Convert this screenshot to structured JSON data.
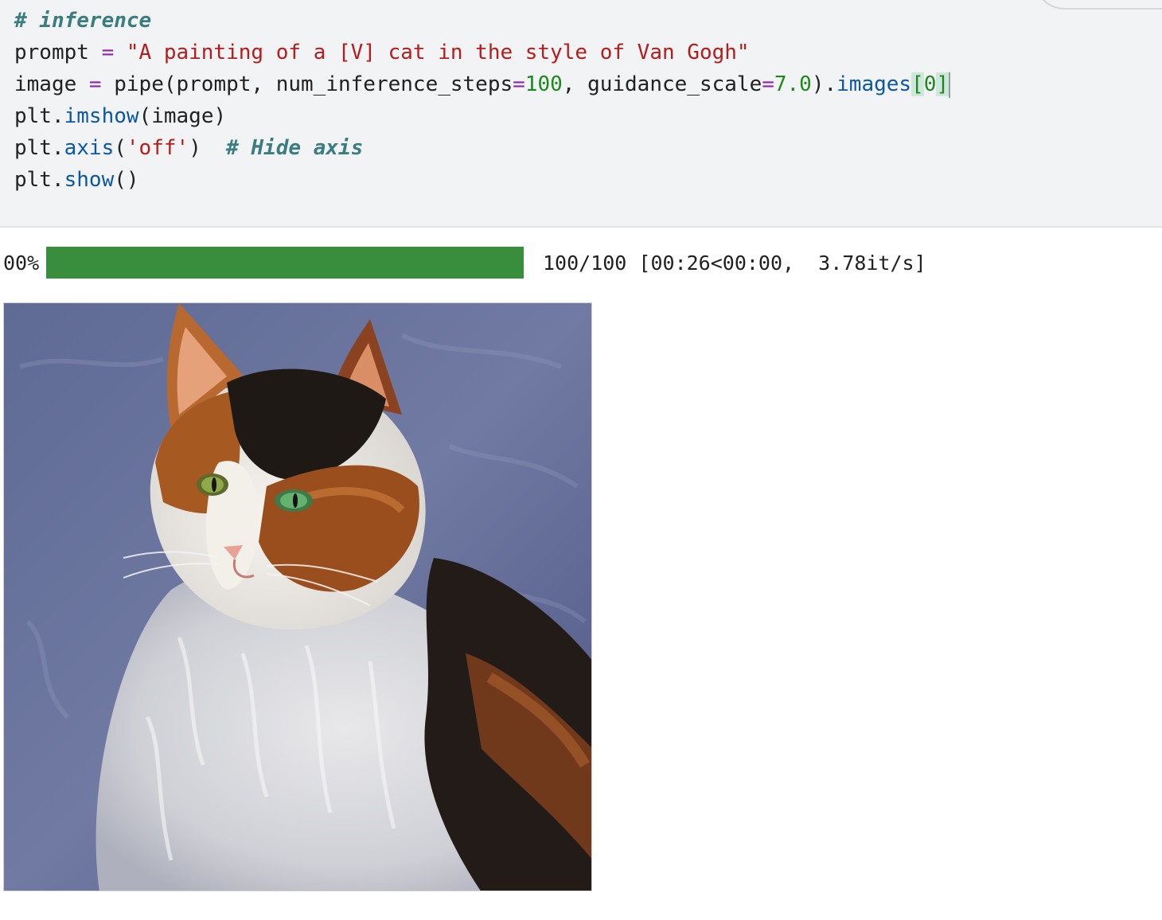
{
  "code_cell": {
    "lines": [
      [
        {
          "t": "# inference",
          "c": "cm"
        }
      ],
      [
        {
          "t": "prompt ",
          "c": ""
        },
        {
          "t": "=",
          "c": "op"
        },
        {
          "t": " ",
          "c": ""
        },
        {
          "t": "\"A painting of a [V] cat in the style of Van Gogh\"",
          "c": "st"
        }
      ],
      [
        {
          "t": "image ",
          "c": ""
        },
        {
          "t": "=",
          "c": "op"
        },
        {
          "t": " pipe(prompt, num_inference_steps",
          "c": ""
        },
        {
          "t": "=",
          "c": "op"
        },
        {
          "t": "100",
          "c": "nu"
        },
        {
          "t": ", guidance_scale",
          "c": ""
        },
        {
          "t": "=",
          "c": "op"
        },
        {
          "t": "7.0",
          "c": "nu"
        },
        {
          "t": ").",
          "c": ""
        },
        {
          "t": "images",
          "c": "fn"
        },
        {
          "t": "[",
          "c": "br"
        },
        {
          "t": "0",
          "c": "nu"
        },
        {
          "t": "]",
          "c": "br"
        }
      ],
      [
        {
          "t": "plt.",
          "c": ""
        },
        {
          "t": "imshow",
          "c": "fn"
        },
        {
          "t": "(image)",
          "c": ""
        }
      ],
      [
        {
          "t": "plt.",
          "c": ""
        },
        {
          "t": "axis",
          "c": "fn"
        },
        {
          "t": "(",
          "c": ""
        },
        {
          "t": "'off'",
          "c": "st"
        },
        {
          "t": ")  ",
          "c": ""
        },
        {
          "t": "# Hide axis",
          "c": "cm"
        }
      ],
      [
        {
          "t": "plt.",
          "c": ""
        },
        {
          "t": "show",
          "c": "fn"
        },
        {
          "t": "()",
          "c": ""
        }
      ]
    ]
  },
  "output": {
    "progress_percent_label": "00%",
    "progress_fraction": 1.0,
    "progress_stats": "100/100 [00:26<00:00,  3.78it/s]",
    "bar_color": "#388e3c",
    "image_description_icon": "calico-cat-painting"
  },
  "colors": {
    "cell_background": "#f2f3f5",
    "comment": "#3a7d80",
    "string": "#b71c1c",
    "number": "#1b8a1b",
    "function": "#0b57a6",
    "operator": "#8e24aa"
  }
}
